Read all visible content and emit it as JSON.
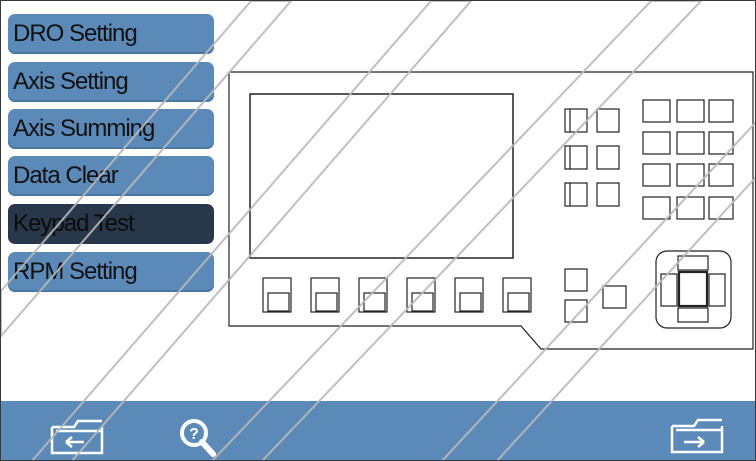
{
  "menu": {
    "items": [
      {
        "label": "DRO Setting"
      },
      {
        "label": "Axis Setting"
      },
      {
        "label": "Axis Summing"
      },
      {
        "label": "Data Clear"
      },
      {
        "label": "Keypad Test"
      },
      {
        "label": "RPM Setting"
      }
    ],
    "active_index": 4
  },
  "colors": {
    "menu_button": "#5b8ab8",
    "menu_button_active": "#28384a",
    "bottom_bar": "#5b8ab8",
    "outline": "#222222"
  },
  "bottom_bar": {
    "left_icon": "folder-back-icon",
    "center_icon": "zoom-search-icon",
    "right_icon": "folder-exit-icon"
  }
}
